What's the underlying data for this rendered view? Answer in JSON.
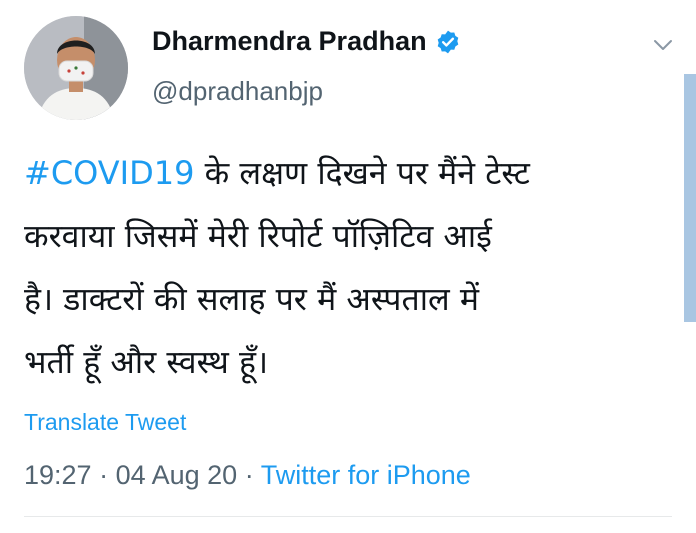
{
  "author": {
    "display_name": "Dharmendra Pradhan",
    "handle": "@dpradhanbjp",
    "verified": true,
    "avatar_icon": "profile-photo-masked-man"
  },
  "tweet": {
    "hashtag": "#COVID19",
    "lines": {
      "line1": " के लक्षण दिखने पर मैंने टेस्ट",
      "line2": "करवाया जिसमें मेरी रिपोर्ट पॉज़िटिव आई",
      "line3": "है। डाक्टरों की सलाह पर मैं अस्पताल में",
      "line4": "भर्ती हूँ और स्वस्थ हूँ।"
    }
  },
  "actions": {
    "translate_label": "Translate Tweet",
    "more_icon": "chevron-down-icon"
  },
  "meta": {
    "time": "19:27",
    "sep1": " · ",
    "date": "04 Aug 20",
    "sep2": " · ",
    "source": "Twitter for iPhone"
  },
  "colors": {
    "accent": "#1d9bf0",
    "secondary_text": "#536471",
    "primary_text": "#0f1419"
  }
}
